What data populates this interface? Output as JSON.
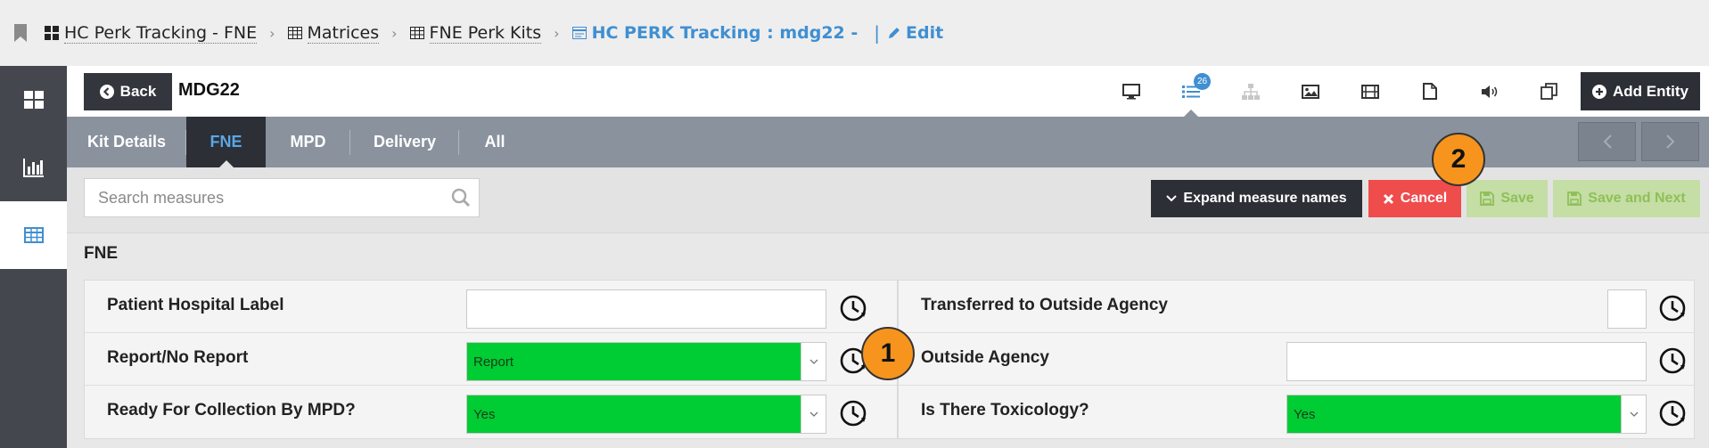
{
  "breadcrumb": {
    "items": [
      {
        "label": "HC Perk Tracking - FNE",
        "icon": "dashboard-grid-icon"
      },
      {
        "label": "Matrices",
        "icon": "table-icon"
      },
      {
        "label": "FNE Perk Kits",
        "icon": "table-icon"
      },
      {
        "label": "HC PERK Tracking : mdg22  -",
        "icon": "form-icon"
      }
    ],
    "edit_label": "Edit"
  },
  "rail": {
    "items": [
      "dashboard-icon",
      "chart-icon",
      "table-icon"
    ],
    "active": 2
  },
  "header": {
    "back_label": "Back",
    "title": "MDG22",
    "badge_count": "26",
    "add_entity_label": "Add Entity",
    "tools": [
      "monitor-icon",
      "list-icon",
      "hierarchy-icon",
      "image-icon",
      "film-icon",
      "document-icon",
      "audio-icon",
      "copy-icon"
    ]
  },
  "tabs": [
    {
      "label": "Kit Details",
      "active": false
    },
    {
      "label": "FNE",
      "active": true
    },
    {
      "label": "MPD",
      "active": false
    },
    {
      "label": "Delivery",
      "active": false
    },
    {
      "label": "All",
      "active": false
    }
  ],
  "toolbar": {
    "search_placeholder": "Search measures",
    "expand_label": "Expand measure names",
    "cancel_label": "Cancel",
    "save_label": "Save",
    "save_next_label": "Save and Next"
  },
  "form": {
    "section_title": "FNE",
    "left": [
      {
        "label": "Patient Hospital Label",
        "type": "text",
        "value": ""
      },
      {
        "label": "Report/No Report",
        "type": "select",
        "value": "Report"
      },
      {
        "label": "Ready For Collection By MPD?",
        "type": "select",
        "value": "Yes"
      }
    ],
    "right": [
      {
        "label": "Transferred to Outside Agency",
        "type": "checkbox",
        "value": ""
      },
      {
        "label": "Outside Agency",
        "type": "text",
        "value": ""
      },
      {
        "label": "Is There Toxicology?",
        "type": "select",
        "value": "Yes"
      }
    ]
  },
  "callouts": [
    "1",
    "2"
  ],
  "colors": {
    "accent": "#3f8fd2",
    "cancel": "#ef4c4c",
    "select_green": "#00cc33",
    "callout": "#f7941d"
  }
}
